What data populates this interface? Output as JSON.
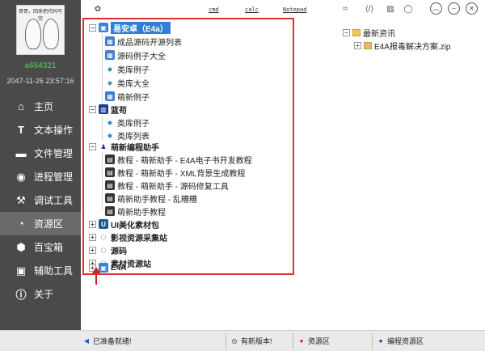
{
  "sidebar": {
    "avatar_caption": "哥哥，回来把代码写完",
    "username": "a654321",
    "datetime": "2047-11-26 23:57:16",
    "items": [
      {
        "label": "主页",
        "icon": "home-icon"
      },
      {
        "label": "文本操作",
        "icon": "text-icon"
      },
      {
        "label": "文件管理",
        "icon": "folder-icon"
      },
      {
        "label": "进程管理",
        "icon": "process-icon"
      },
      {
        "label": "调试工具",
        "icon": "wrench-icon"
      },
      {
        "label": "资源区",
        "icon": "pie-icon",
        "active": true
      },
      {
        "label": "百宝箱",
        "icon": "hexagon-icon"
      },
      {
        "label": "辅助工具",
        "icon": "briefcase-icon"
      },
      {
        "label": "关于",
        "icon": "info-icon"
      }
    ]
  },
  "topbar": {
    "links": [
      "cmd",
      "calc",
      "Notepad"
    ]
  },
  "tree": {
    "root_label": "易安卓（E4a）",
    "e4a_children": [
      "成品源码开源列表",
      "源码例子大全",
      "类库例子",
      "类库大全",
      "萌新例子"
    ],
    "node2": "篮苟",
    "node2_children": [
      "类库例子",
      "类库列表"
    ],
    "node3": "萌新编程助手",
    "node3_children": [
      "教程 - 萌新助手 - E4A电子书开发教程",
      "教程 - 萌新助手 - XML背景生成教程",
      "教程 - 萌新助手 - 源码修复工具",
      "萌新助手教程 - 乱糟糟",
      "萌新助手教程"
    ],
    "collapsed": [
      "UI美化素材包",
      "影视资源采集站",
      "源码",
      "素材资源站",
      "E4A"
    ]
  },
  "right": {
    "folder": "最新资讯",
    "file": "E4A报毒解决方案.zip"
  },
  "status": {
    "ready": "已准备就绪!",
    "new_version": "有新版本!",
    "resource": "资源区",
    "edit_resource": "编程资源区"
  },
  "colors": {
    "sidebar_bg": "#4a4a4a",
    "highlight": "#2f7fd8",
    "annotation_red": "#e03030",
    "username_green": "#4caf50"
  }
}
